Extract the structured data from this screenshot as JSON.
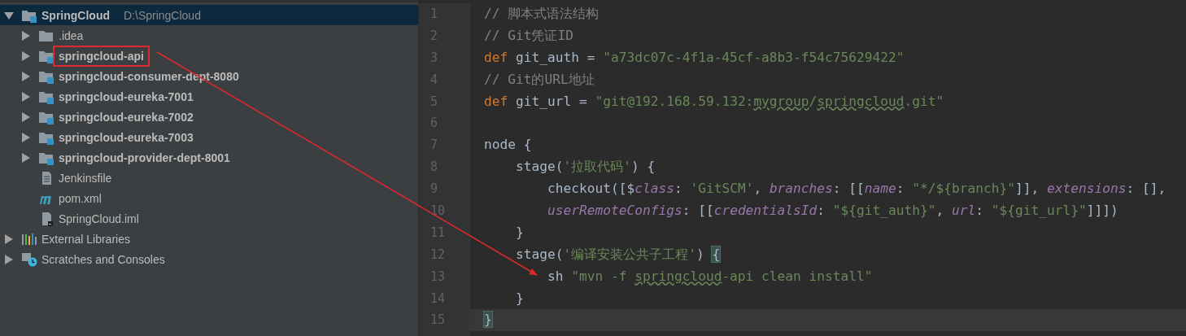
{
  "project_tree": [
    {
      "label": "SpringCloud",
      "path": "D:\\SpringCloud",
      "kind": "module",
      "expanded": true,
      "selected": true,
      "annotated": false,
      "children": [
        {
          "label": ".idea",
          "kind": "folder",
          "expanded": false,
          "selected": false,
          "annotated": false
        },
        {
          "label": "springcloud-api",
          "kind": "module",
          "expanded": false,
          "selected": false,
          "annotated": true
        },
        {
          "label": "springcloud-consumer-dept-8080",
          "kind": "module",
          "expanded": false,
          "selected": false,
          "annotated": false
        },
        {
          "label": "springcloud-eureka-7001",
          "kind": "module",
          "expanded": false,
          "selected": false,
          "annotated": false
        },
        {
          "label": "springcloud-eureka-7002",
          "kind": "module",
          "expanded": false,
          "selected": false,
          "annotated": false
        },
        {
          "label": "springcloud-eureka-7003",
          "kind": "module",
          "expanded": false,
          "selected": false,
          "annotated": false
        },
        {
          "label": "springcloud-provider-dept-8001",
          "kind": "module",
          "expanded": false,
          "selected": false,
          "annotated": false
        },
        {
          "label": "Jenkinsfile",
          "kind": "text-file",
          "selected": false,
          "annotated": false
        },
        {
          "label": "pom.xml",
          "kind": "maven-file",
          "selected": false,
          "annotated": false
        },
        {
          "label": "SpringCloud.iml",
          "kind": "iml-file",
          "selected": false,
          "annotated": false
        }
      ]
    },
    {
      "label": "External Libraries",
      "kind": "libraries",
      "expanded": false,
      "selected": false,
      "annotated": false
    },
    {
      "label": "Scratches and Consoles",
      "kind": "scratches",
      "expanded": false,
      "selected": false,
      "annotated": false
    }
  ],
  "editor": {
    "lines": [
      {
        "number": "1",
        "current": false,
        "tokens": [
          {
            "kind": "comment",
            "text": "// 脚本式语法结构"
          }
        ]
      },
      {
        "number": "2",
        "current": false,
        "tokens": [
          {
            "kind": "comment",
            "text": "// Git凭证ID"
          }
        ]
      },
      {
        "number": "3",
        "current": false,
        "tokens": [
          {
            "kind": "keyword",
            "text": "def "
          },
          {
            "kind": "plain",
            "text": "git_auth = "
          },
          {
            "kind": "string",
            "text": "\"a73dc07c-4f1a-45cf-a8b3-f54c75629422\""
          }
        ]
      },
      {
        "number": "4",
        "current": false,
        "tokens": [
          {
            "kind": "comment",
            "text": "// Git的URL地址"
          }
        ]
      },
      {
        "number": "5",
        "current": false,
        "tokens": [
          {
            "kind": "keyword",
            "text": "def "
          },
          {
            "kind": "plain",
            "text": "git_url = "
          },
          {
            "kind": "string",
            "text": "\"git@192.168.59.132:"
          },
          {
            "kind": "string-typo",
            "text": "mygroup"
          },
          {
            "kind": "string",
            "text": "/"
          },
          {
            "kind": "string-typo",
            "text": "springcloud"
          },
          {
            "kind": "string",
            "text": ".git\""
          }
        ]
      },
      {
        "number": "6",
        "current": false
      },
      {
        "number": "7",
        "current": false,
        "tokens": [
          {
            "kind": "plain",
            "text": "node {"
          }
        ]
      },
      {
        "number": "8",
        "current": false,
        "tokens": [
          {
            "kind": "plain",
            "text": "    stage("
          },
          {
            "kind": "string",
            "text": "'拉取代码'"
          },
          {
            "kind": "plain",
            "text": ") {"
          }
        ]
      },
      {
        "number": "9",
        "current": false,
        "tokens": [
          {
            "kind": "plain",
            "text": "        checkout([$"
          },
          {
            "kind": "param",
            "text": "class"
          },
          {
            "kind": "plain",
            "text": ": "
          },
          {
            "kind": "string",
            "text": "'GitSCM'"
          },
          {
            "kind": "plain",
            "text": ", "
          },
          {
            "kind": "param",
            "text": "branches"
          },
          {
            "kind": "plain",
            "text": ": [["
          },
          {
            "kind": "param",
            "text": "name"
          },
          {
            "kind": "plain",
            "text": ": "
          },
          {
            "kind": "string",
            "text": "\"*/${branch}\""
          },
          {
            "kind": "plain",
            "text": "]], "
          },
          {
            "kind": "param",
            "text": "extensions"
          },
          {
            "kind": "plain",
            "text": ": [],"
          }
        ]
      },
      {
        "number": "10",
        "current": false,
        "tokens": [
          {
            "kind": "param",
            "text": "        userRemoteConfigs"
          },
          {
            "kind": "plain",
            "text": ": [["
          },
          {
            "kind": "param",
            "text": "credentialsId"
          },
          {
            "kind": "plain",
            "text": ": "
          },
          {
            "kind": "string",
            "text": "\"${git_auth}\""
          },
          {
            "kind": "plain",
            "text": ", "
          },
          {
            "kind": "param",
            "text": "url"
          },
          {
            "kind": "plain",
            "text": ": "
          },
          {
            "kind": "string",
            "text": "\"${git_url}\""
          },
          {
            "kind": "plain",
            "text": "]]])"
          }
        ]
      },
      {
        "number": "11",
        "current": false,
        "tokens": [
          {
            "kind": "plain",
            "text": "    }"
          }
        ]
      },
      {
        "number": "12",
        "current": false,
        "tokens": [
          {
            "kind": "plain",
            "text": "    stage("
          },
          {
            "kind": "string",
            "text": "'编译安装公共子工程'"
          },
          {
            "kind": "plain",
            "text": ") "
          },
          {
            "kind": "brace-match",
            "text": "{"
          }
        ]
      },
      {
        "number": "13",
        "current": false,
        "tokens": [
          {
            "kind": "plain",
            "text": "        sh "
          },
          {
            "kind": "string",
            "text": "\"mvn -f "
          },
          {
            "kind": "string-typo",
            "text": "springcloud"
          },
          {
            "kind": "string",
            "text": "-api clean install\""
          }
        ]
      },
      {
        "number": "14",
        "current": false,
        "tokens": [
          {
            "kind": "plain",
            "text": "    }"
          }
        ]
      },
      {
        "number": "15",
        "current": true,
        "tokens": [
          {
            "kind": "brace-match",
            "text": "}"
          }
        ]
      }
    ]
  }
}
